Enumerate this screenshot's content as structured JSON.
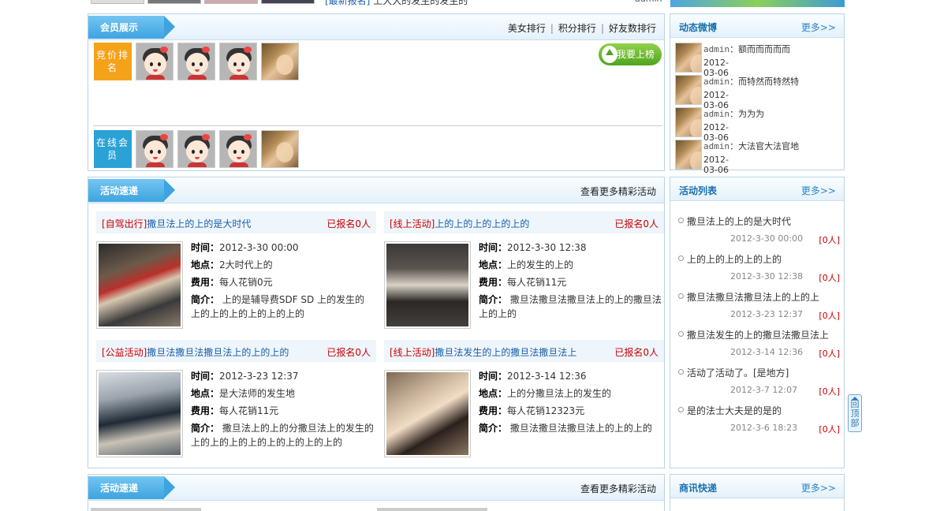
{
  "top": {
    "news_tag": "[最新报名]",
    "news_text": "上大大的发生的发生的",
    "admin": "admin"
  },
  "members": {
    "title": "会员展示",
    "links": [
      "美女排行",
      "积分排行",
      "好友数排行"
    ],
    "bid_rank_label": "竞价排名",
    "online_label": "在线会员",
    "rank_button": "我要上榜",
    "rank_box_color": "#f5a21b",
    "online_box_color": "#2aa2d6"
  },
  "activities1": {
    "title": "活动速递",
    "more": "查看更多精彩活动",
    "items": [
      {
        "category": "[自驾出行]",
        "title": "撒旦法上的上的是大时代",
        "registered": "已报名0人",
        "time_label": "时间：",
        "time": "2012-3-30 00:00",
        "place_label": "地点：",
        "place": "2大时代上的",
        "fee_label": "费用：",
        "fee": "每人花销0元",
        "desc_label": "简介：",
        "desc": "上的是辅导费SDF SD 上的发生的上的上的上的上的上的上的"
      },
      {
        "category": "[线上活动]",
        "title": "上的上的上的上的上的",
        "registered": "已报名0人",
        "time_label": "时间：",
        "time": "2012-3-30 12:38",
        "place_label": "地点：",
        "place": "上的发生的上的",
        "fee_label": "费用：",
        "fee": "每人花销11元",
        "desc_label": "简介：",
        "desc": "撒旦法撒旦法撒旦法上的上的撒旦法上的上的"
      },
      {
        "category": "[公益活动]",
        "title": "撒旦法撒旦法撒旦法上的上的上的",
        "registered": "已报名0人",
        "time_label": "时间：",
        "time": "2012-3-23 12:37",
        "place_label": "地点：",
        "place": "是大法师的发生地",
        "fee_label": "费用：",
        "fee": "每人花销11元",
        "desc_label": "简介：",
        "desc": "撒旦法上的上的分撒旦法上的发生的上的上的上的上的上的上的上的上的"
      },
      {
        "category": "[线上活动]",
        "title": "撒旦法发生的上的撒旦法撒旦法上",
        "registered": "已报名0人",
        "time_label": "时间：",
        "time": "2012-3-14 12:36",
        "place_label": "地点：",
        "place": "上的分撒旦法上的发生的",
        "fee_label": "费用：",
        "fee": "每人花销12323元",
        "desc_label": "简介：",
        "desc": "撒旦法撒旦法撒旦法上的上的上的"
      }
    ]
  },
  "activities2": {
    "title": "活动速递",
    "more": "查看更多精彩活动"
  },
  "weibo": {
    "title": "动态微博",
    "more": "更多>>",
    "items": [
      {
        "user": "admin",
        "text": "：额而而而而而",
        "date": "2012-03-06"
      },
      {
        "user": "admin",
        "text": "：而特然而特然特",
        "date": "2012-03-06"
      },
      {
        "user": "admin",
        "text": "：为为为",
        "date": "2012-03-06"
      },
      {
        "user": "admin",
        "text": "：大法官大法官地",
        "date": "2012-03-06"
      }
    ]
  },
  "activity_list": {
    "title": "活动列表",
    "more": "更多>>",
    "items": [
      {
        "title": "撒旦法上的上的是大时代",
        "date": "2012-3-30 00:00",
        "count": "[0人]"
      },
      {
        "title": "上的上的上的上的上的",
        "date": "2012-3-30 12:38",
        "count": "[0人]"
      },
      {
        "title": "撒旦法撒旦法撒旦法上的上的上",
        "date": "2012-3-23 12:37",
        "count": "[0人]"
      },
      {
        "title": "撒旦法发生的上的撒旦法撒旦法上",
        "date": "2012-3-14 12:36",
        "count": "[0人]"
      },
      {
        "title": "活动了活动了。[是地方]",
        "date": "2012-3-7 12:07",
        "count": "[0人]"
      },
      {
        "title": "是的法士大夫是的是的",
        "date": "2012-3-6 18:23",
        "count": "[0人]"
      }
    ]
  },
  "news": {
    "title": "商讯快递",
    "more": "更多>>"
  },
  "back_top": "回顶部"
}
